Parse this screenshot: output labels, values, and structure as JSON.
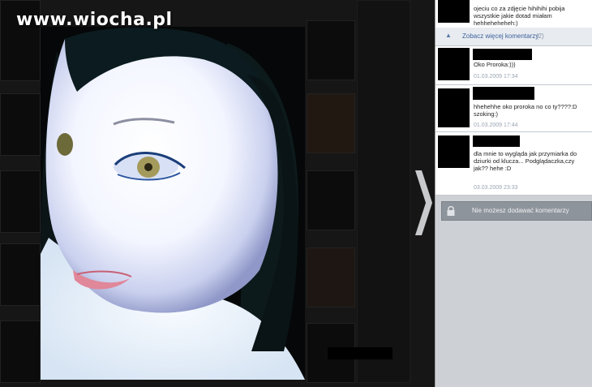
{
  "watermark": "www.wiocha.pl",
  "more_comments": {
    "label": "Zobacz więcej komentarzy",
    "count": "(2)"
  },
  "comments": [
    {
      "text": "ojeciu co za zdjęcie hihihihi pobija wszystkie jakie dotad miałam hehheheheheh:)",
      "date": ""
    },
    {
      "text": "Oko Proroka:)))",
      "date": "01.03.2009 17:34"
    },
    {
      "text": "hhehehhe oko proroka no co ty????:D szoking:)",
      "date": "01.03.2009 17:44"
    },
    {
      "text": "dla mnie to wygląda jak przymiarka do dziurki od klucza... Podglądaczka,czy jak?? hehe :D",
      "date": "03.03.2009 23:33"
    }
  ],
  "no_comment_label": "Nie możesz dodawać komentarzy",
  "icons": {
    "next": "chevron-right-icon",
    "lock": "lock-icon",
    "more": "chevron-up-icon"
  },
  "colors": {
    "panel_bg": "#cdd1d6",
    "link": "#3b5f9a",
    "date": "#9aa4b2",
    "button_bg": "#8e949b"
  }
}
